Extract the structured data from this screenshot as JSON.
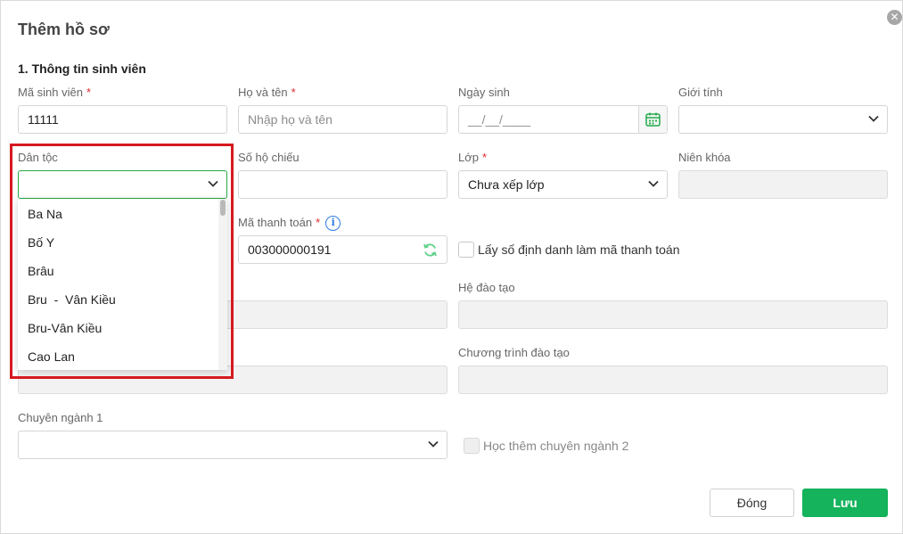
{
  "dialog": {
    "title": "Thêm hồ sơ",
    "close_icon": "close-icon"
  },
  "section": {
    "title": "1. Thông tin sinh viên"
  },
  "fields": {
    "student_id": {
      "label": "Mã sinh viên",
      "required": "*",
      "value": "11111"
    },
    "full_name": {
      "label": "Họ và tên",
      "required": "*",
      "placeholder": "Nhập họ và tên"
    },
    "birth_date": {
      "label": "Ngày sinh",
      "placeholder": "__/__/____"
    },
    "gender": {
      "label": "Giới tính",
      "value": ""
    },
    "ethnicity": {
      "label": "Dân tộc",
      "value": ""
    },
    "passport": {
      "label": "Số hộ chiếu",
      "value": ""
    },
    "class": {
      "label": "Lớp",
      "required": "*",
      "value": "Chưa xếp lớp"
    },
    "academic_year": {
      "label": "Niên khóa",
      "value": ""
    },
    "payment_code": {
      "label": "Mã thanh toán",
      "required": "*",
      "info": "i",
      "value": "003000000191"
    },
    "use_id_as_payment": {
      "label": "Lấy số định danh làm mã thanh toán",
      "checked": false
    },
    "training_system": {
      "label": "Hệ đào tạo",
      "value": ""
    },
    "training_program": {
      "label": "Chương trình đào tạo",
      "value": ""
    },
    "major1": {
      "label": "Chuyên ngành 1",
      "value": ""
    },
    "extra_major": {
      "label": "Học thêm chuyên ngành 2",
      "checked": false
    }
  },
  "ethnicity_options": [
    "Ba Na",
    "Bố Y",
    "Brâu",
    "Bru  -  Vân Kiều",
    "Bru-Vân Kiều",
    "Cao Lan"
  ],
  "buttons": {
    "close": "Đóng",
    "save": "Lưu"
  },
  "colors": {
    "accent": "#14b35c",
    "required": "#e0262b",
    "highlight": "#d61920",
    "info": "#2d7be5"
  }
}
